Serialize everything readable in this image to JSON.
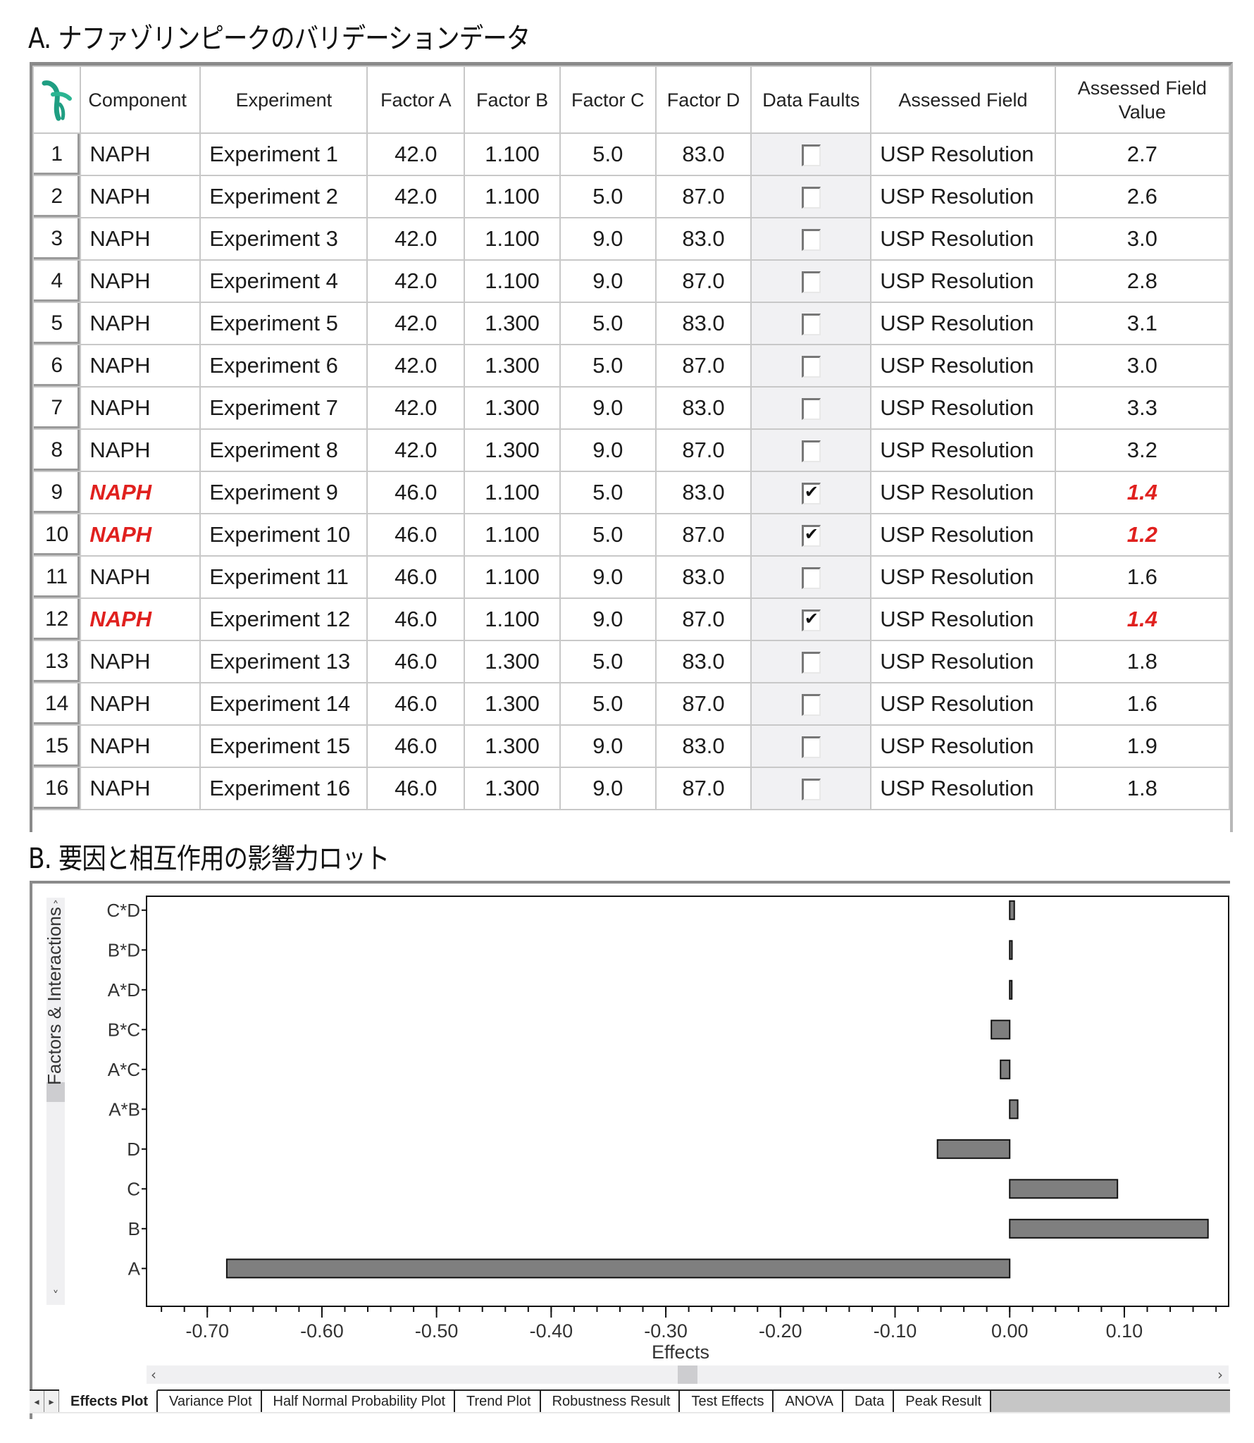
{
  "section_a": {
    "title": "A. ナファゾリンピークのバリデーションデータ"
  },
  "section_b": {
    "title": "B. 要因と相互作用の影響力ロット"
  },
  "table": {
    "logo_icon": "app-logo-icon",
    "columns": [
      "",
      "Component",
      "Experiment",
      "Factor A",
      "Factor B",
      "Factor C",
      "Factor D",
      "Data Faults",
      "Assessed Field",
      "Assessed Field Value"
    ],
    "fault_color": "#e0201e",
    "rows": [
      {
        "n": "1",
        "component": "NAPH",
        "experiment": "Experiment 1",
        "a": "42.0",
        "b": "1.100",
        "c": "5.0",
        "d": "83.0",
        "fault": false,
        "field": "USP Resolution",
        "value": "2.7"
      },
      {
        "n": "2",
        "component": "NAPH",
        "experiment": "Experiment 2",
        "a": "42.0",
        "b": "1.100",
        "c": "5.0",
        "d": "87.0",
        "fault": false,
        "field": "USP Resolution",
        "value": "2.6"
      },
      {
        "n": "3",
        "component": "NAPH",
        "experiment": "Experiment 3",
        "a": "42.0",
        "b": "1.100",
        "c": "9.0",
        "d": "83.0",
        "fault": false,
        "field": "USP Resolution",
        "value": "3.0"
      },
      {
        "n": "4",
        "component": "NAPH",
        "experiment": "Experiment 4",
        "a": "42.0",
        "b": "1.100",
        "c": "9.0",
        "d": "87.0",
        "fault": false,
        "field": "USP Resolution",
        "value": "2.8"
      },
      {
        "n": "5",
        "component": "NAPH",
        "experiment": "Experiment 5",
        "a": "42.0",
        "b": "1.300",
        "c": "5.0",
        "d": "83.0",
        "fault": false,
        "field": "USP Resolution",
        "value": "3.1"
      },
      {
        "n": "6",
        "component": "NAPH",
        "experiment": "Experiment 6",
        "a": "42.0",
        "b": "1.300",
        "c": "5.0",
        "d": "87.0",
        "fault": false,
        "field": "USP Resolution",
        "value": "3.0"
      },
      {
        "n": "7",
        "component": "NAPH",
        "experiment": "Experiment 7",
        "a": "42.0",
        "b": "1.300",
        "c": "9.0",
        "d": "83.0",
        "fault": false,
        "field": "USP Resolution",
        "value": "3.3"
      },
      {
        "n": "8",
        "component": "NAPH",
        "experiment": "Experiment 8",
        "a": "42.0",
        "b": "1.300",
        "c": "9.0",
        "d": "87.0",
        "fault": false,
        "field": "USP Resolution",
        "value": "3.2"
      },
      {
        "n": "9",
        "component": "NAPH",
        "experiment": "Experiment 9",
        "a": "46.0",
        "b": "1.100",
        "c": "5.0",
        "d": "83.0",
        "fault": true,
        "field": "USP Resolution",
        "value": "1.4"
      },
      {
        "n": "10",
        "component": "NAPH",
        "experiment": "Experiment 10",
        "a": "46.0",
        "b": "1.100",
        "c": "5.0",
        "d": "87.0",
        "fault": true,
        "field": "USP Resolution",
        "value": "1.2"
      },
      {
        "n": "11",
        "component": "NAPH",
        "experiment": "Experiment 11",
        "a": "46.0",
        "b": "1.100",
        "c": "9.0",
        "d": "83.0",
        "fault": false,
        "field": "USP Resolution",
        "value": "1.6"
      },
      {
        "n": "12",
        "component": "NAPH",
        "experiment": "Experiment 12",
        "a": "46.0",
        "b": "1.100",
        "c": "9.0",
        "d": "87.0",
        "fault": true,
        "field": "USP Resolution",
        "value": "1.4"
      },
      {
        "n": "13",
        "component": "NAPH",
        "experiment": "Experiment 13",
        "a": "46.0",
        "b": "1.300",
        "c": "5.0",
        "d": "83.0",
        "fault": false,
        "field": "USP Resolution",
        "value": "1.8"
      },
      {
        "n": "14",
        "component": "NAPH",
        "experiment": "Experiment 14",
        "a": "46.0",
        "b": "1.300",
        "c": "5.0",
        "d": "87.0",
        "fault": false,
        "field": "USP Resolution",
        "value": "1.6"
      },
      {
        "n": "15",
        "component": "NAPH",
        "experiment": "Experiment 15",
        "a": "46.0",
        "b": "1.300",
        "c": "9.0",
        "d": "83.0",
        "fault": false,
        "field": "USP Resolution",
        "value": "1.9"
      },
      {
        "n": "16",
        "component": "NAPH",
        "experiment": "Experiment 16",
        "a": "46.0",
        "b": "1.300",
        "c": "9.0",
        "d": "87.0",
        "fault": false,
        "field": "USP Resolution",
        "value": "1.8"
      }
    ]
  },
  "chart_data": {
    "type": "bar",
    "orientation": "horizontal",
    "title": "",
    "xlabel": "Effects",
    "ylabel": "Factors & Interactions",
    "categories": [
      "A",
      "B",
      "C",
      "D",
      "A*B",
      "A*C",
      "B*C",
      "A*D",
      "B*D",
      "C*D"
    ],
    "values": [
      -0.683,
      0.173,
      0.094,
      -0.063,
      0.007,
      -0.008,
      -0.016,
      0.001,
      0.002,
      0.004
    ],
    "xlim": [
      -0.753,
      0.191
    ],
    "xticks": [
      -0.7,
      -0.6,
      -0.5,
      -0.4,
      -0.3,
      -0.2,
      -0.1,
      0.0,
      0.1
    ],
    "xtick_labels": [
      "-0.70",
      "-0.60",
      "-0.50",
      "-0.40",
      "-0.30",
      "-0.20",
      "-0.10",
      "0.00",
      "0.10"
    ],
    "minor_tick_step": 0.02,
    "grid": false,
    "bar_color": "#7f7f7f",
    "bar_edge_color": "#111111"
  },
  "scrollbars": {
    "up_icon": "˄",
    "down_icon": "˅",
    "left_icon": "‹",
    "right_icon": "›"
  },
  "tabs": {
    "nav_prev": "◂",
    "nav_next": "▸",
    "items": [
      {
        "label": "Effects Plot",
        "active": true
      },
      {
        "label": "Variance Plot",
        "active": false
      },
      {
        "label": "Half Normal Probability Plot",
        "active": false
      },
      {
        "label": "Trend Plot",
        "active": false
      },
      {
        "label": "Robustness Result",
        "active": false
      },
      {
        "label": "Test Effects",
        "active": false
      },
      {
        "label": "ANOVA",
        "active": false
      },
      {
        "label": "Data",
        "active": false
      },
      {
        "label": "Peak Result",
        "active": false
      }
    ]
  }
}
